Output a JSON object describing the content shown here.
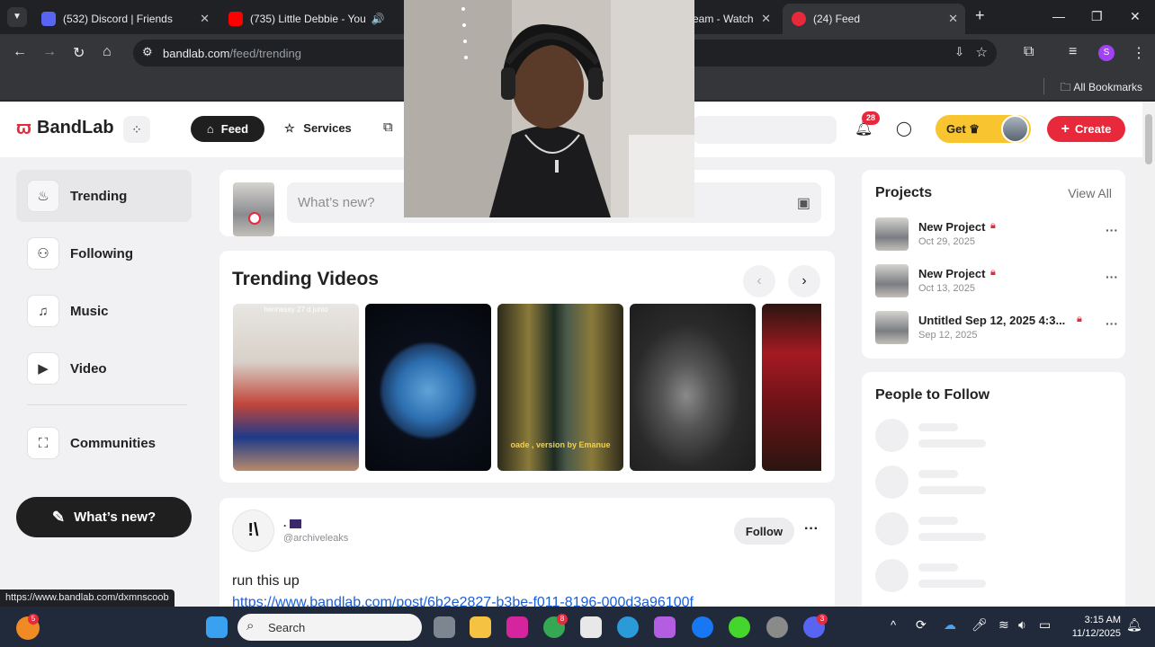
{
  "browser": {
    "tabs": [
      {
        "title": "(532) Discord | Friends",
        "favicon_color": "#5865f2"
      },
      {
        "title": "(735) Little Debbie - You",
        "favicon_color": "#ff0000"
      },
      {
        "title": "eam - Watch",
        "favicon_color": "#9146ff"
      },
      {
        "title": "(24) Feed",
        "favicon_color": "#e8283b"
      }
    ],
    "url_host": "bandlab.com",
    "url_path": "/feed/trending",
    "profile_initial": "S",
    "bookmarks_label": "All Bookmarks"
  },
  "header": {
    "logo_text": "BandLab",
    "feed_label": "Feed",
    "services_label": "Services",
    "notification_count": "28",
    "get_label": "Get",
    "create_label": "Create"
  },
  "sidebar": {
    "items": [
      {
        "label": "Trending",
        "icon": "flame-icon"
      },
      {
        "label": "Following",
        "icon": "people-icon"
      },
      {
        "label": "Music",
        "icon": "music-note-icon"
      },
      {
        "label": "Video",
        "icon": "play-icon"
      },
      {
        "label": "Communities",
        "icon": "communities-icon"
      }
    ],
    "whats_new_label": "What’s new?"
  },
  "composer": {
    "placeholder": "What’s new?"
  },
  "trending": {
    "title": "Trending Videos",
    "video1_caption": "hennessy 27 d junio",
    "video3_caption": "oade , version by Emanue"
  },
  "post": {
    "name": ".",
    "handle": "@archiveleaks",
    "follow_label": "Follow",
    "text": "run this up",
    "link": "https://www.bandlab.com/post/6b2e2827-b3be-f011-8196-000d3a96100f"
  },
  "projects": {
    "title": "Projects",
    "view_all": "View All",
    "items": [
      {
        "name": "New Project",
        "date": "Oct 29, 2025"
      },
      {
        "name": "New Project",
        "date": "Oct 13, 2025"
      },
      {
        "name": "Untitled Sep 12, 2025 4:3...",
        "date": "Sep 12, 2025"
      }
    ]
  },
  "people_to_follow": {
    "title": "People to Follow"
  },
  "status_bar": {
    "url": "https://www.bandlab.com/dxmnscoob"
  },
  "taskbar": {
    "search_label": "Search",
    "time": "3:15 AM",
    "date": "11/12/2025",
    "start_badge": "5",
    "chrome_badge": "8",
    "discord_badge": "3"
  }
}
